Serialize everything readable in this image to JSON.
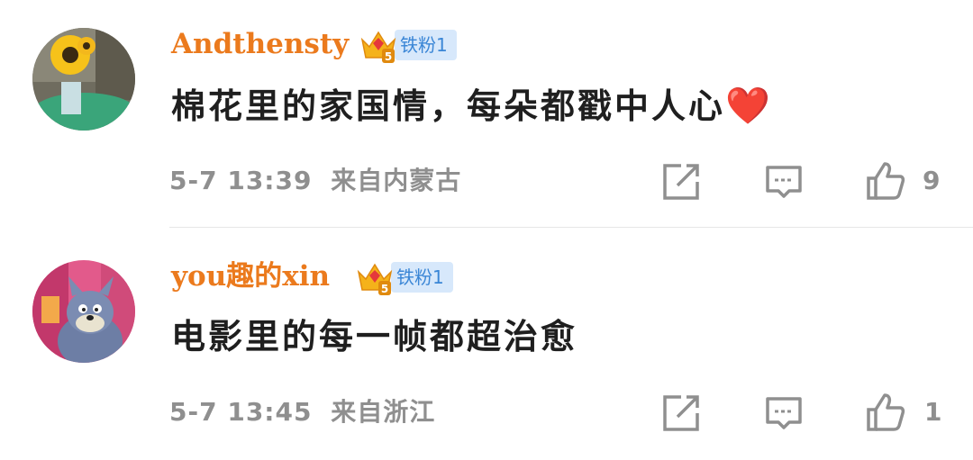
{
  "comments": [
    {
      "username": "Andthensty",
      "fan_badge": "铁粉1",
      "crown_level": "5",
      "text": "棉花里的家国情，每朵都戳中人心",
      "emoji": "❤️",
      "time": "5-7 13:39",
      "location": "来自内蒙古",
      "likes": "9"
    },
    {
      "username": "you趣的xin",
      "fan_badge": "铁粉1",
      "crown_level": "5",
      "text": "电影里的每一帧都超治愈",
      "emoji": "",
      "time": "5-7 13:45",
      "location": "来自浙江",
      "likes": "1"
    }
  ],
  "colors": {
    "username": "#eb7a1d",
    "fan_badge_bg": "#d7e8fb",
    "fan_badge_text": "#3a86d6",
    "meta": "#8f8f8f"
  },
  "icons": {
    "share": "share-icon",
    "comment": "comment-icon",
    "like": "thumbs-up-icon",
    "crown": "crown-badge-icon"
  }
}
